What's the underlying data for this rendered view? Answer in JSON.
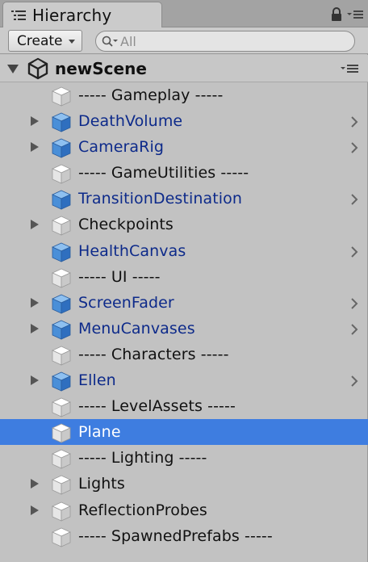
{
  "tab": {
    "title": "Hierarchy",
    "icon": "list-icon",
    "lock_icon": "lock-icon",
    "menu_icon": "tab-menu-icon"
  },
  "toolbar": {
    "create_label": "Create",
    "search_placeholder": "All",
    "search_value": ""
  },
  "scene": {
    "name": "newScene",
    "logo_icon": "unity-logo-icon",
    "menu_icon": "scene-menu-icon"
  },
  "colors": {
    "selection": "#3e7de0",
    "prefab_text": "#0d2a8a",
    "prefab_cube": "#4a8fd8",
    "plain_cube": "#f2f2f2"
  },
  "items": [
    {
      "label": "----- Gameplay -----",
      "prefab": false,
      "expandable": false,
      "selected": false,
      "chevron": false
    },
    {
      "label": "DeathVolume",
      "prefab": true,
      "expandable": true,
      "selected": false,
      "chevron": true
    },
    {
      "label": "CameraRig",
      "prefab": true,
      "expandable": true,
      "selected": false,
      "chevron": true
    },
    {
      "label": "----- GameUtilities -----",
      "prefab": false,
      "expandable": false,
      "selected": false,
      "chevron": false
    },
    {
      "label": "TransitionDestination",
      "prefab": true,
      "expandable": false,
      "selected": false,
      "chevron": true
    },
    {
      "label": "Checkpoints",
      "prefab": false,
      "expandable": true,
      "selected": false,
      "chevron": false
    },
    {
      "label": "HealthCanvas",
      "prefab": true,
      "expandable": false,
      "selected": false,
      "chevron": true
    },
    {
      "label": "----- UI -----",
      "prefab": false,
      "expandable": false,
      "selected": false,
      "chevron": false
    },
    {
      "label": "ScreenFader",
      "prefab": true,
      "expandable": true,
      "selected": false,
      "chevron": true
    },
    {
      "label": "MenuCanvases",
      "prefab": true,
      "expandable": true,
      "selected": false,
      "chevron": true
    },
    {
      "label": "----- Characters -----",
      "prefab": false,
      "expandable": false,
      "selected": false,
      "chevron": false
    },
    {
      "label": "Ellen",
      "prefab": true,
      "expandable": true,
      "selected": false,
      "chevron": true
    },
    {
      "label": "----- LevelAssets -----",
      "prefab": false,
      "expandable": false,
      "selected": false,
      "chevron": false
    },
    {
      "label": "Plane",
      "prefab": false,
      "expandable": false,
      "selected": true,
      "chevron": false
    },
    {
      "label": "----- Lighting -----",
      "prefab": false,
      "expandable": false,
      "selected": false,
      "chevron": false
    },
    {
      "label": "Lights",
      "prefab": false,
      "expandable": true,
      "selected": false,
      "chevron": false
    },
    {
      "label": "ReflectionProbes",
      "prefab": false,
      "expandable": true,
      "selected": false,
      "chevron": false
    },
    {
      "label": "----- SpawnedPrefabs -----",
      "prefab": false,
      "expandable": false,
      "selected": false,
      "chevron": false
    }
  ]
}
